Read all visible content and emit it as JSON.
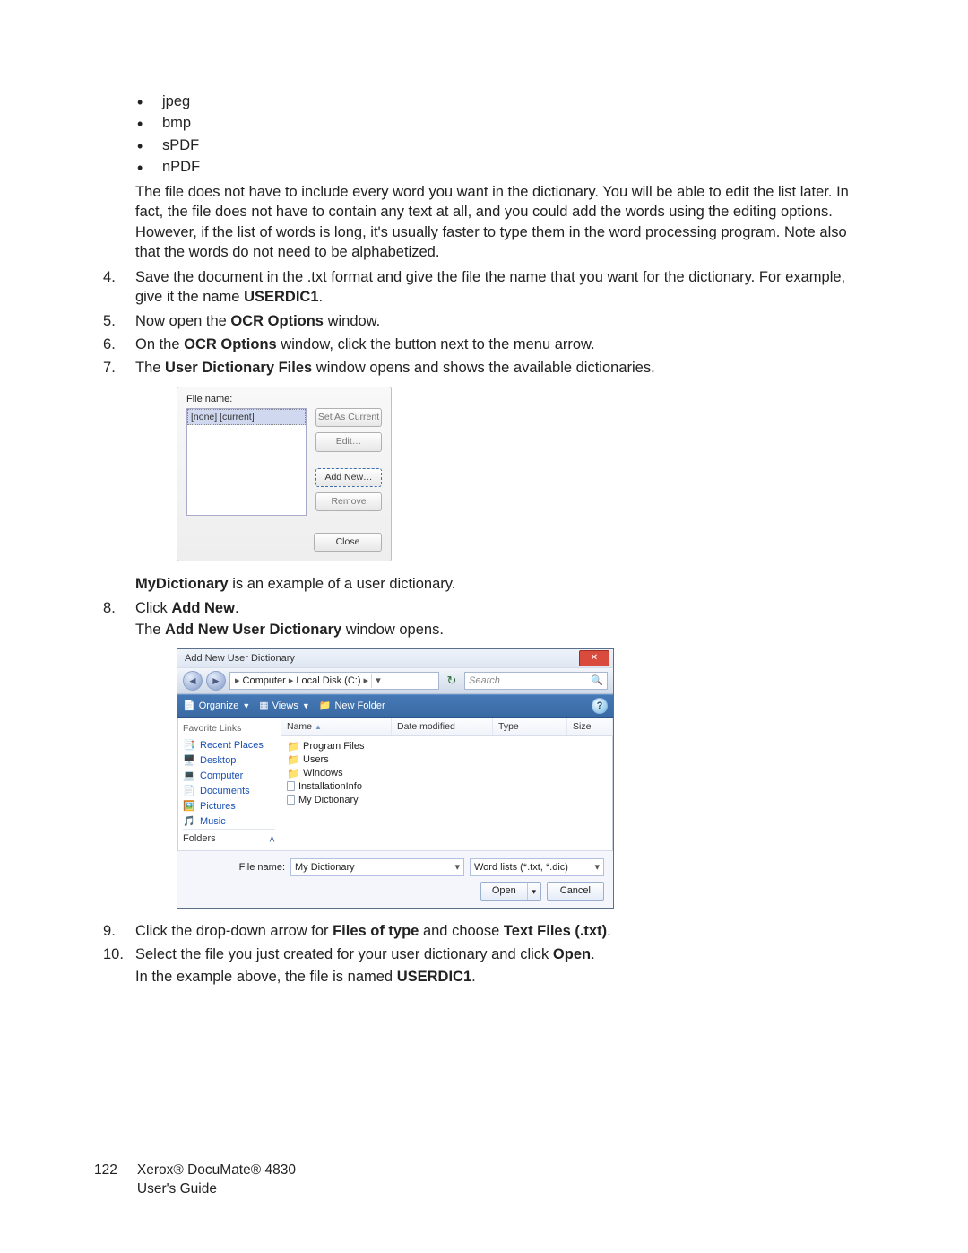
{
  "bullets": [
    "jpeg",
    "bmp",
    "sPDF",
    "nPDF"
  ],
  "paragraph_after_bullets": "The file does not have to include every word you want in the dictionary. You will be able to edit the list later. In fact, the file does not have to contain any text at all, and you could add the words using the editing options. However, if the list of words is long, it's usually faster to type them in the word processing program. Note also that the words do not need to be alphabetized.",
  "step4_a": "Save the document in the .txt format and give the file the name that you want for the dictionary. For example, give it the name ",
  "step4_bold": "USERDIC1",
  "step4_b": ".",
  "step5_a": "Now open the ",
  "step5_bold": "OCR Options",
  "step5_b": " window.",
  "step6_a": "On the ",
  "step6_bold": "OCR Options",
  "step6_b": " window, click the button next to the menu arrow.",
  "step7_a": "The ",
  "step7_bold": "User Dictionary Files",
  "step7_b": " window opens and shows the available dictionaries.",
  "udf": {
    "file_name_label": "File name:",
    "selected_item": "[none] [current]",
    "buttons": {
      "set_current": "Set As Current",
      "edit": "Edit…",
      "add_new": "Add New…",
      "remove": "Remove",
      "close": "Close"
    }
  },
  "mydict_line_a_bold": "MyDictionary",
  "mydict_line_a": " is an example of a user dictionary.",
  "step8_a": "Click ",
  "step8_bold": "Add New",
  "step8_b": ".",
  "step8_line2_a": "The ",
  "step8_line2_bold": "Add New User Dictionary",
  "step8_line2_b": " window opens.",
  "explorer": {
    "title": "Add New User Dictionary",
    "crumb1": "Computer",
    "crumb2": "Local Disk (C:)",
    "search_placeholder": "Search",
    "toolbar": {
      "organize": "Organize",
      "views": "Views",
      "new_folder": "New Folder"
    },
    "nav": {
      "header": "Favorite Links",
      "items": [
        "Recent Places",
        "Desktop",
        "Computer",
        "Documents",
        "Pictures",
        "Music"
      ],
      "folders_label": "Folders"
    },
    "columns": {
      "name": "Name",
      "date": "Date modified",
      "type": "Type",
      "size": "Size"
    },
    "files": {
      "folders": [
        "Program Files",
        "Users",
        "Windows"
      ],
      "docs": [
        "InstallationInfo",
        "My Dictionary"
      ]
    },
    "file_name_label": "File name:",
    "file_name_value": "My Dictionary",
    "filter_value": "Word lists (*.txt, *.dic)",
    "open_btn": "Open",
    "cancel_btn": "Cancel"
  },
  "step9_a": "Click the drop-down arrow for ",
  "step9_bold1": "Files of type",
  "step9_mid": " and choose ",
  "step9_bold2": "Text Files (.txt)",
  "step9_b": ".",
  "step10_a": "Select the file you just created for your user dictionary and click ",
  "step10_bold": "Open",
  "step10_b": ".",
  "step10_line2_a": "In the example above, the file is named ",
  "step10_line2_bold": "USERDIC1",
  "step10_line2_b": ".",
  "footer": {
    "page_num": "122",
    "line1": "Xerox® DocuMate® 4830",
    "line2": "User's Guide"
  }
}
